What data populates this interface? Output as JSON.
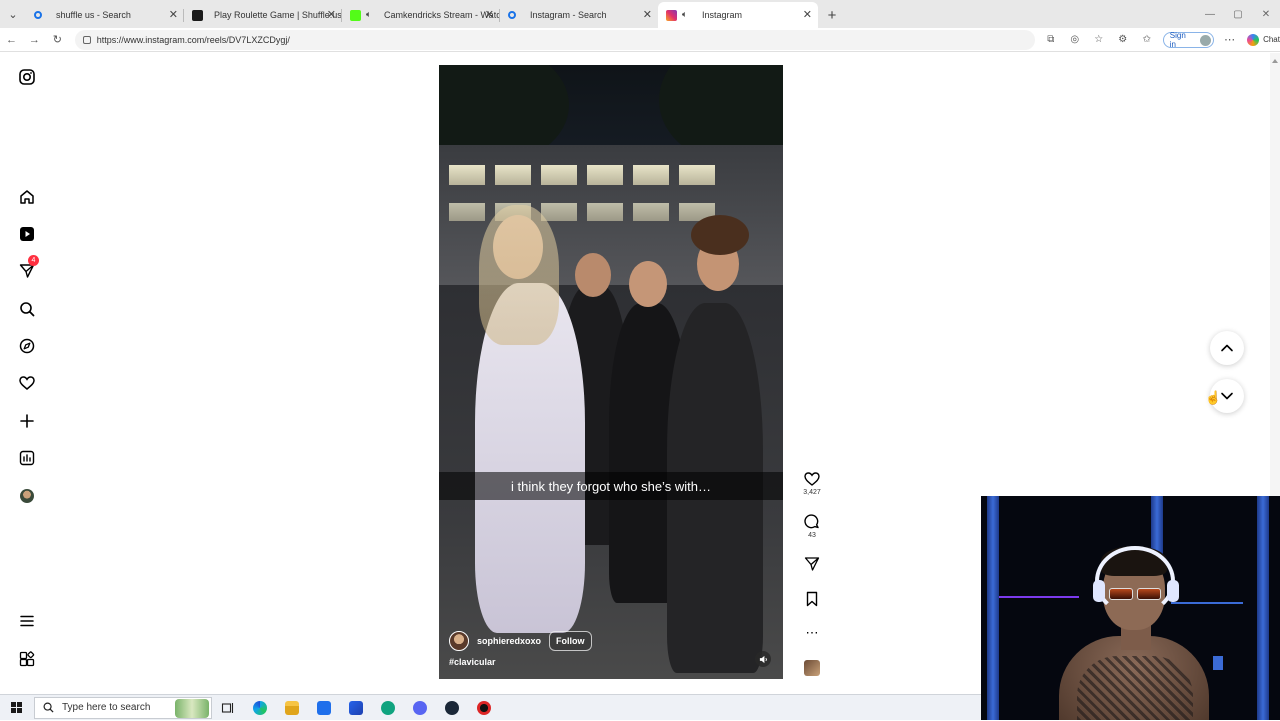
{
  "browser": {
    "tabs": [
      {
        "title": "shuffle us - Search",
        "favicon_color": "#1a73e8"
      },
      {
        "title": "Play Roulette Game | Shuffle.us | I",
        "favicon_color": "#1a1a1a"
      },
      {
        "title": "Camkendricks Stream - Watch",
        "favicon_color": "#53fc18"
      },
      {
        "title": "Instagram - Search",
        "favicon_color": "#1a73e8"
      },
      {
        "title": "Instagram",
        "favicon_color": "#e1306c",
        "active": true
      }
    ],
    "url": "https://www.instagram.com/reels/DV7LXZCDygj/",
    "sign_in_label": "Sign in",
    "chat_label": "Chat"
  },
  "sidebar": {
    "items": [
      {
        "name": "instagram-logo-icon"
      },
      {
        "name": "home-icon"
      },
      {
        "name": "reels-icon"
      },
      {
        "name": "messages-icon",
        "badge": "4"
      },
      {
        "name": "search-icon"
      },
      {
        "name": "explore-icon"
      },
      {
        "name": "notifications-icon"
      },
      {
        "name": "create-icon"
      },
      {
        "name": "dashboard-icon"
      },
      {
        "name": "profile-avatar"
      },
      {
        "name": "more-menu-icon"
      },
      {
        "name": "also-from-meta-icon"
      }
    ]
  },
  "reel": {
    "caption": "i think they forgot who she’s with…",
    "username": "sophieredxoxo",
    "follow_label": "Follow",
    "hashtag": "#clavicular",
    "likes": "3,427",
    "comments": "43"
  },
  "colors": {
    "badge": "#ff3040",
    "accent_blue": "#1a5bbf"
  },
  "taskbar": {
    "search_placeholder": "Type here to search"
  }
}
